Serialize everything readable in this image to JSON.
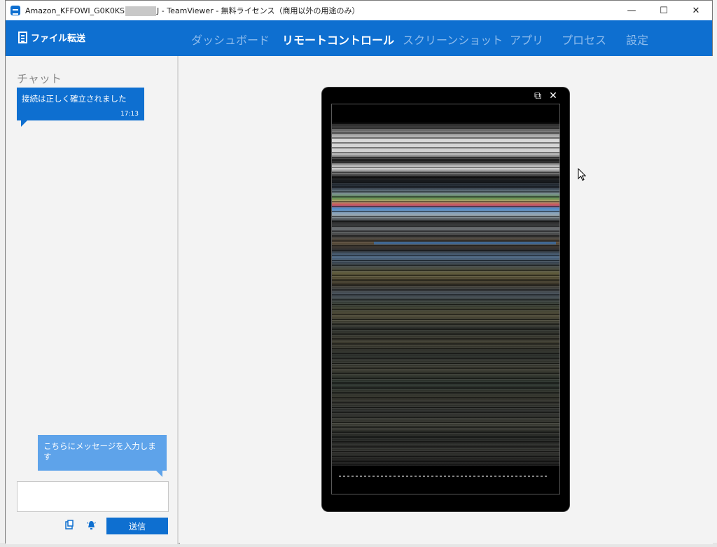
{
  "window": {
    "title_prefix": "Amazon_KFFOWI_G0K0KS",
    "title_suffix": "J - TeamViewer - 無料ライセンス（商用以外の用途のみ）",
    "minimize": "—",
    "maximize": "☐",
    "close": "✕"
  },
  "nav": {
    "file_transfer": "ファイル転送",
    "tabs": [
      "ダッシュボード",
      "リモートコントロール",
      "スクリーンショット",
      "アプリ",
      "プロセス",
      "設定"
    ],
    "active_tab": "リモートコントロール"
  },
  "chat": {
    "title": "チャット",
    "messages": [
      {
        "text": "接続は正しく確立されました",
        "time": "17:13"
      }
    ],
    "input_hint": "こちらにメッセージを入力します",
    "input_value": "",
    "send_label": "送信"
  },
  "device": {
    "popout_icon": "⧉",
    "close_icon": "✕"
  },
  "colors": {
    "accent": "#0e6fd0",
    "tab_inactive": "#8fbcec",
    "hint_bubble": "#5ea3ea"
  }
}
